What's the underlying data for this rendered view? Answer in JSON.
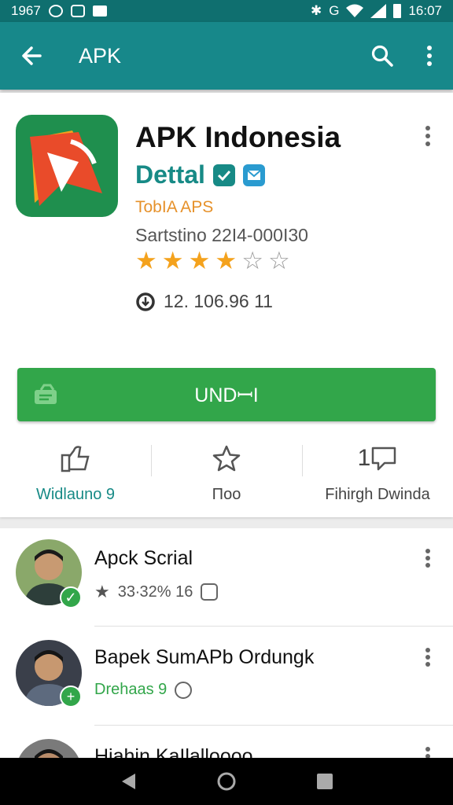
{
  "status_bar": {
    "time_left": "1967",
    "time_right": "16:07",
    "network": "G"
  },
  "app_bar": {
    "title": "APK",
    "back_icon": "arrow-left-icon",
    "search_icon": "search-icon",
    "more_icon": "more-vert-icon"
  },
  "app": {
    "name": "APK Indonesia",
    "developer": "Dettal",
    "category": "TobIA APS",
    "content_rating": "Sartstino 22I4-000I30",
    "rating_stars": 4,
    "rating_max": 6,
    "downloads": "12. 106.96 11",
    "install_label": "UNDꟷI"
  },
  "stats": [
    {
      "label": "Widlauno 9",
      "icon": "thumbs-up-icon"
    },
    {
      "label": "Πoo",
      "icon": "star-icon"
    },
    {
      "label": "Fihirgh Dwinda",
      "icon_prefix": "1",
      "icon": "chat-icon"
    }
  ],
  "list": [
    {
      "title": "Apck Scrial",
      "meta": "33∙32% 16",
      "meta_style": "gray"
    },
    {
      "title": "Bapek SumAPb Ordungk",
      "meta": "Drehaas 9",
      "meta_style": "green"
    },
    {
      "title": "Hiahin KaIlalloooo",
      "meta": "",
      "meta_style": "gray"
    }
  ],
  "colors": {
    "status_bar": "#0f6f6f",
    "app_bar": "#17888a",
    "accent": "#178a86",
    "install": "#32a64a",
    "star": "#f4a21d",
    "category": "#e6912a"
  }
}
